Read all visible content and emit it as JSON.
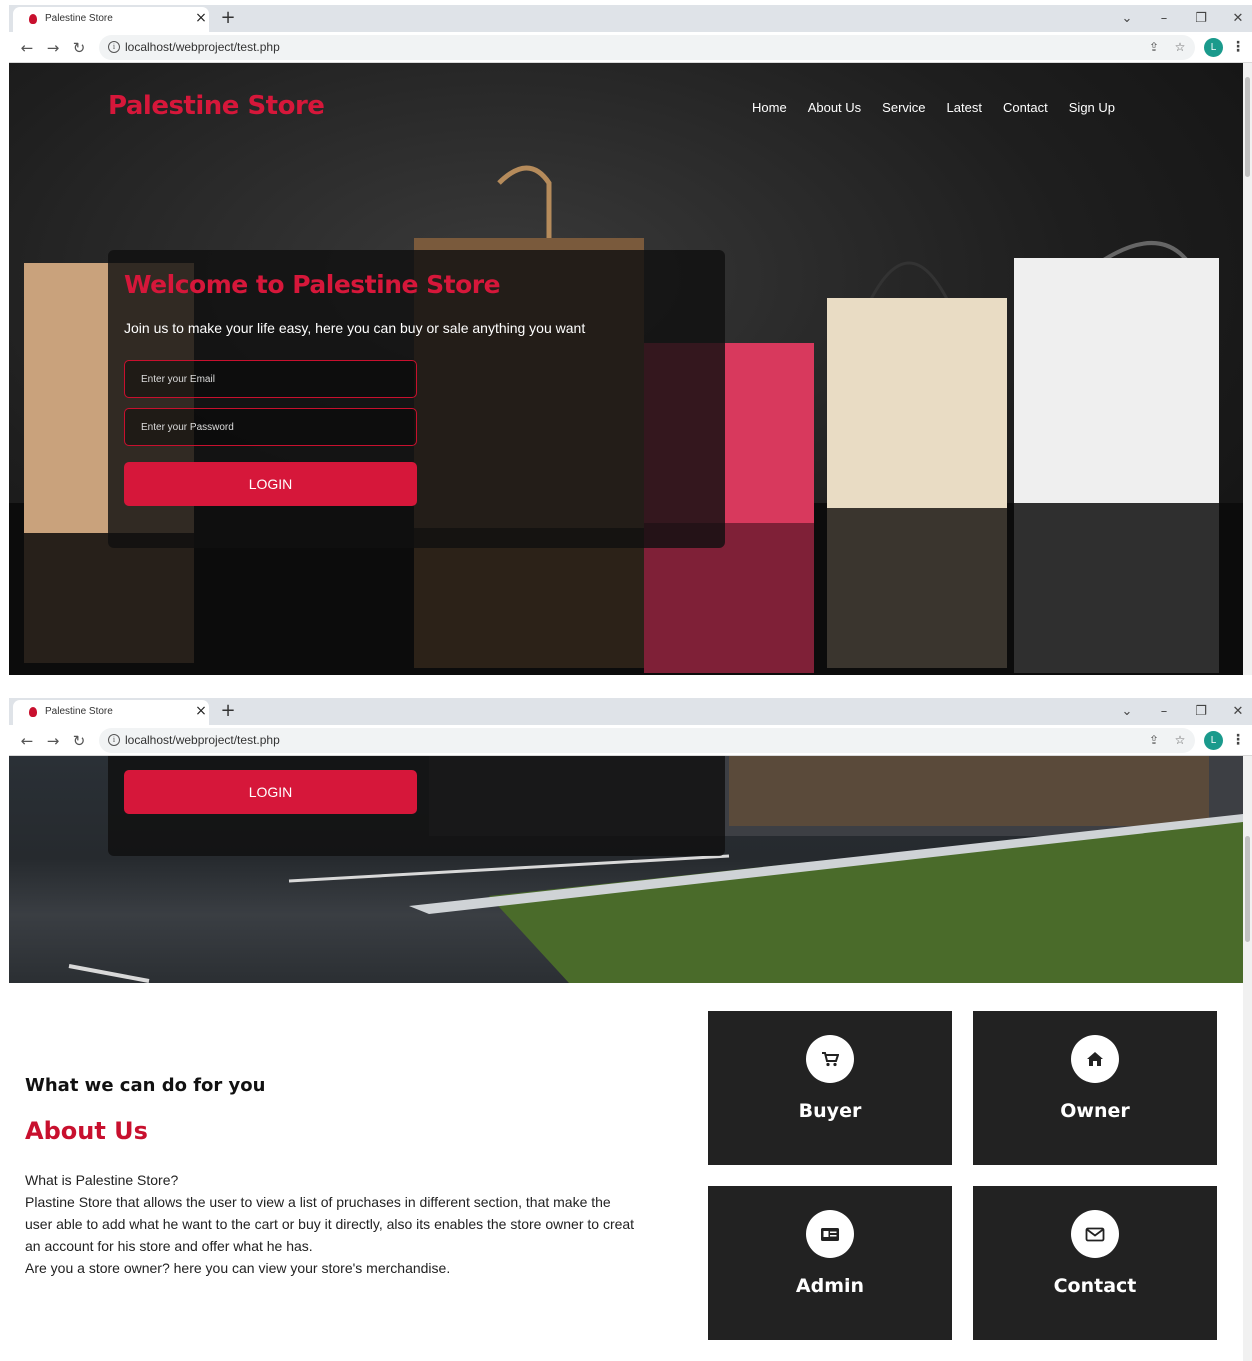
{
  "browser": {
    "tab_title": "Palestine Store",
    "url": "localhost/webproject/test.php",
    "profile_initial": "L"
  },
  "site": {
    "brand": "Palestine Store",
    "nav": [
      "Home",
      "About Us",
      "Service",
      "Latest",
      "Contact",
      "Sign Up"
    ]
  },
  "hero": {
    "title": "Welcome to Palestine Store",
    "tagline": "Join us to make your life easy, here you can buy or sale anything you want",
    "email_placeholder": "Enter your Email",
    "password_placeholder": "Enter your Password",
    "login_label": "LOGIN"
  },
  "about": {
    "subheading": "What we can do for you",
    "title": "About Us",
    "paragraphs": [
      "What is Palestine Store?",
      "Plastine Store that allows the user to view a list of pruchases in different section, that make the user able to add what he want to the cart or buy it directly, also its enables the store owner to creat an account for his store and offer what he has.",
      "Are you a store owner? here you can view your store's merchandise."
    ]
  },
  "cards": [
    {
      "label": "Buyer",
      "icon": "shopping-cart-icon"
    },
    {
      "label": "Owner",
      "icon": "home-icon"
    },
    {
      "label": "Admin",
      "icon": "id-card-icon"
    },
    {
      "label": "Contact",
      "icon": "envelope-icon"
    }
  ],
  "colors": {
    "brand_red": "#d6173a",
    "card_bg": "#222222"
  }
}
